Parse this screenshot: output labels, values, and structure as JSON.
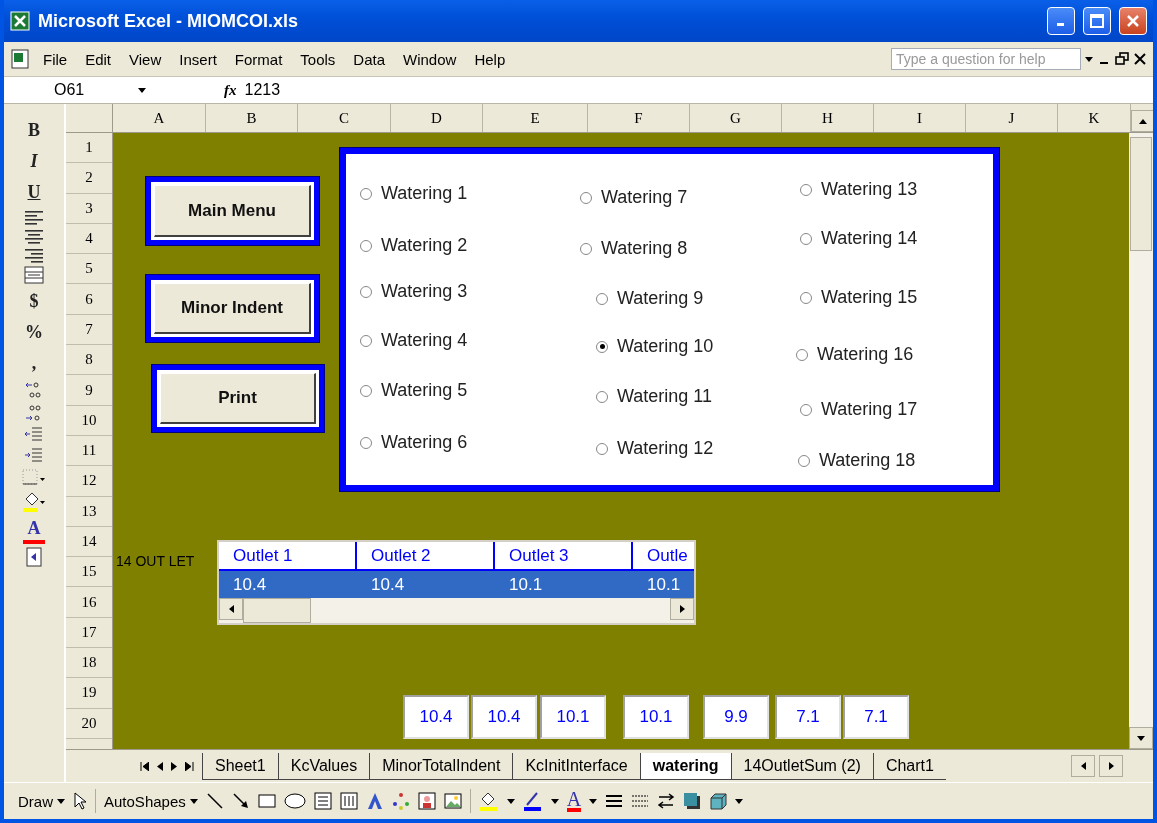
{
  "window": {
    "title": "Microsoft Excel - MIOMCOI.xls"
  },
  "menu": [
    "File",
    "Edit",
    "View",
    "Insert",
    "Format",
    "Tools",
    "Data",
    "Window",
    "Help"
  ],
  "help_box": {
    "placeholder": "Type a question for help"
  },
  "formula_bar": {
    "name_box": "O61",
    "fx": "fx",
    "value": "1213"
  },
  "format_toolbar": {
    "bold": "B",
    "italic": "I",
    "underline": "U",
    "currency": "$",
    "percent": "%",
    "comma": ",",
    "font_color": "A"
  },
  "columns": [
    "A",
    "B",
    "C",
    "D",
    "E",
    "F",
    "G",
    "H",
    "I",
    "J",
    "K"
  ],
  "rows": [
    "1",
    "2",
    "3",
    "4",
    "5",
    "6",
    "7",
    "8",
    "9",
    "10",
    "11",
    "12",
    "13",
    "14",
    "15",
    "16",
    "17",
    "18",
    "19",
    "20"
  ],
  "sheet": {
    "buttons": [
      "Main Menu",
      "Minor Indent",
      "Print"
    ],
    "label": "14 OUT LET",
    "options": [
      {
        "label": "Watering 1",
        "selected": false
      },
      {
        "label": "Watering 2",
        "selected": false
      },
      {
        "label": "Watering 3",
        "selected": false
      },
      {
        "label": "Watering 4",
        "selected": false
      },
      {
        "label": "Watering 5",
        "selected": false
      },
      {
        "label": "Watering 6",
        "selected": false
      },
      {
        "label": "Watering 7",
        "selected": false
      },
      {
        "label": "Watering 8",
        "selected": false
      },
      {
        "label": "Watering 9",
        "selected": false
      },
      {
        "label": "Watering 10",
        "selected": true
      },
      {
        "label": "Watering 11",
        "selected": false
      },
      {
        "label": "Watering 12",
        "selected": false
      },
      {
        "label": "Watering 13",
        "selected": false
      },
      {
        "label": "Watering 14",
        "selected": false
      },
      {
        "label": "Watering 15",
        "selected": false
      },
      {
        "label": "Watering 16",
        "selected": false
      },
      {
        "label": "Watering 17",
        "selected": false
      },
      {
        "label": "Watering 18",
        "selected": false
      }
    ],
    "list_box": {
      "columns": [
        "Outlet 1",
        "Outlet 2",
        "Outlet 3",
        "Outle"
      ],
      "rows": [
        {
          "cells": [
            "10.4",
            "10.4",
            "10.1",
            "10.1"
          ],
          "selected": true
        }
      ]
    },
    "text_boxes": [
      "10.4",
      "10.4",
      "10.1",
      "10.1",
      "9.9",
      "7.1",
      "7.1"
    ]
  },
  "sheet_tabs": [
    {
      "label": "Sheet1",
      "selected": false
    },
    {
      "label": "KcValues",
      "selected": false
    },
    {
      "label": "MinorTotalIndent",
      "selected": false
    },
    {
      "label": "KcInitInterface",
      "selected": false
    },
    {
      "label": "watering",
      "selected": true
    },
    {
      "label": "14OutletSum (2)",
      "selected": false
    },
    {
      "label": "Chart1",
      "selected": false
    }
  ],
  "draw_toolbar": {
    "draw": "Draw",
    "autoshapes": "AutoShapes",
    "font_color": "A"
  }
}
